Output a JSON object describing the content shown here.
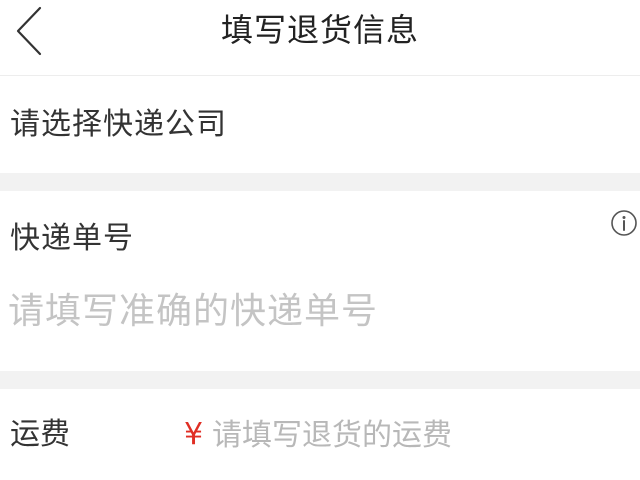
{
  "header": {
    "title": "填写退货信息",
    "back_icon": "chevron-left-icon"
  },
  "courier": {
    "label": "请选择快递公司"
  },
  "tracking": {
    "label": "快递单号",
    "placeholder": "请填写准确的快递单号",
    "value": "",
    "info_icon": "info-circle-icon"
  },
  "fee": {
    "label": "运费",
    "currency_symbol": "¥",
    "placeholder": "请填写退货的运费",
    "value": ""
  },
  "colors": {
    "accent": "#e02e24",
    "separator": "#f2f2f2",
    "placeholder": "#c4c4c4",
    "text": "#333333"
  }
}
